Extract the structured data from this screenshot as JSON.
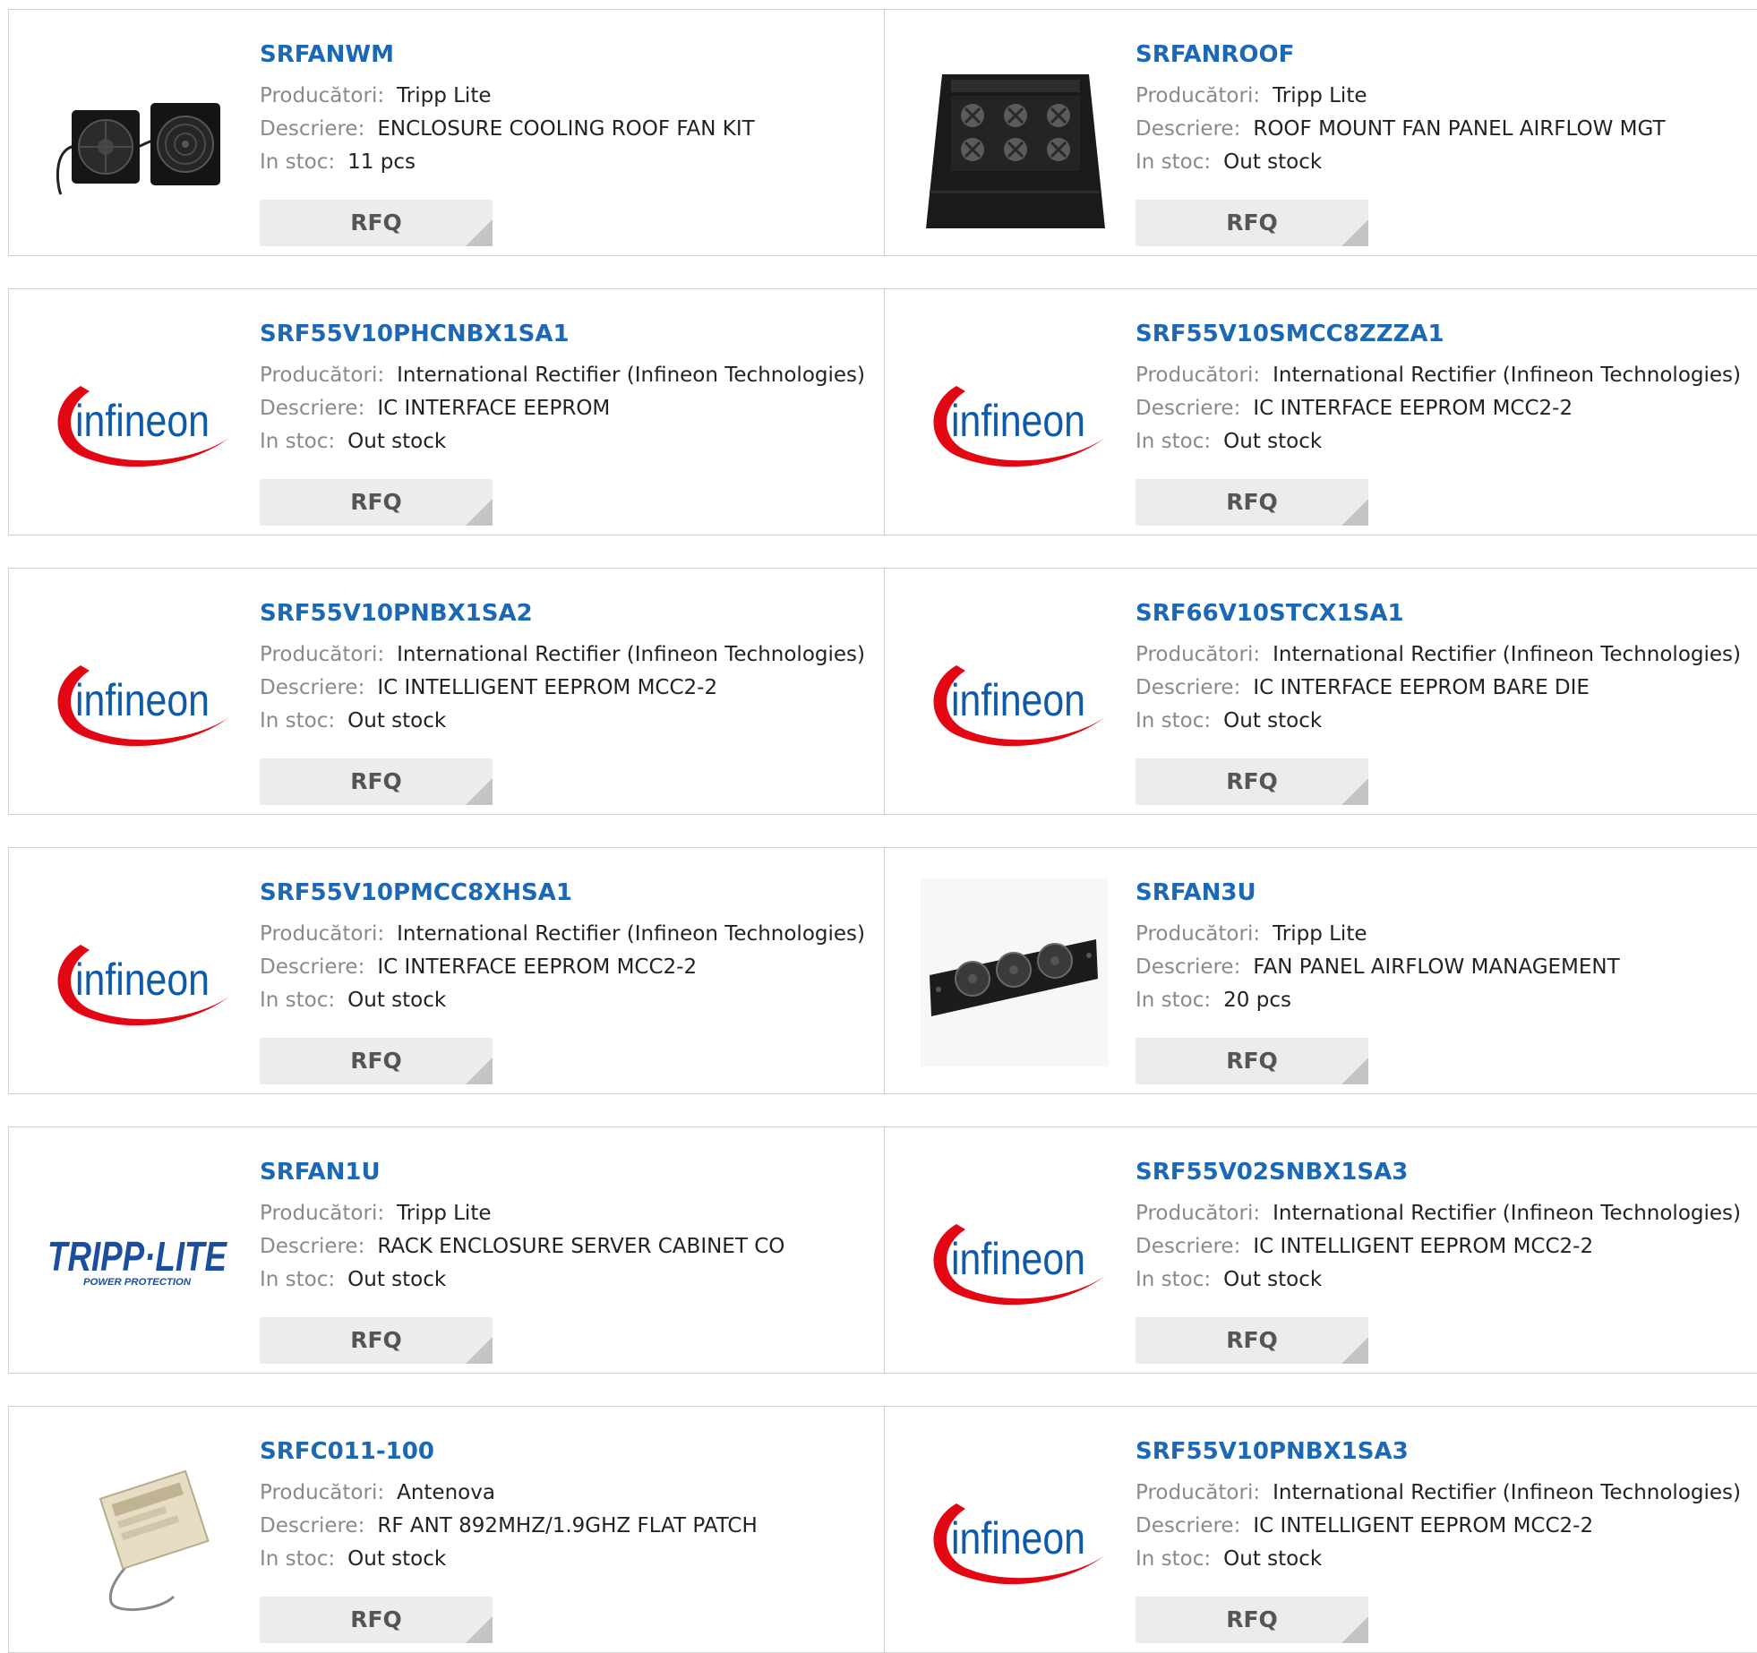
{
  "labels": {
    "manufacturer": "Producători:",
    "description": "Descriere:",
    "stock": "In stoc:",
    "rfq": "RFQ"
  },
  "products": [
    {
      "part": "SRFANWM",
      "manufacturer": "Tripp Lite",
      "description": "ENCLOSURE COOLING ROOF FAN KIT",
      "stock": "11 pcs",
      "image": "twin-fan-kit-image"
    },
    {
      "part": "SRFANROOF",
      "manufacturer": "Tripp Lite",
      "description": "ROOF MOUNT FAN PANEL AIRFLOW MGT",
      "stock": "Out stock",
      "image": "roof-fan-panel-image"
    },
    {
      "part": "SRF55V10PHCNBX1SA1",
      "manufacturer": "International Rectifier (Infineon Technologies)",
      "description": "IC INTERFACE EEPROM",
      "stock": "Out stock",
      "image": "infineon-logo"
    },
    {
      "part": "SRF55V10SMCC8ZZZA1",
      "manufacturer": "International Rectifier (Infineon Technologies)",
      "description": "IC INTERFACE EEPROM MCC2-2",
      "stock": "Out stock",
      "image": "infineon-logo"
    },
    {
      "part": "SRF55V10PNBX1SA2",
      "manufacturer": "International Rectifier (Infineon Technologies)",
      "description": "IC INTELLIGENT EEPROM MCC2-2",
      "stock": "Out stock",
      "image": "infineon-logo"
    },
    {
      "part": "SRF66V10STCX1SA1",
      "manufacturer": "International Rectifier (Infineon Technologies)",
      "description": "IC INTERFACE EEPROM BARE DIE",
      "stock": "Out stock",
      "image": "infineon-logo"
    },
    {
      "part": "SRF55V10PMCC8XHSA1",
      "manufacturer": "International Rectifier (Infineon Technologies)",
      "description": "IC INTERFACE EEPROM MCC2-2",
      "stock": "Out stock",
      "image": "infineon-logo"
    },
    {
      "part": "SRFAN3U",
      "manufacturer": "Tripp Lite",
      "description": "FAN PANEL AIRFLOW MANAGEMENT",
      "stock": "20 pcs",
      "image": "rack-fan-panel-image"
    },
    {
      "part": "SRFAN1U",
      "manufacturer": "Tripp Lite",
      "description": "RACK ENCLOSURE SERVER CABINET CO",
      "stock": "Out stock",
      "image": "tripp-lite-logo"
    },
    {
      "part": "SRF55V02SNBX1SA3",
      "manufacturer": "International Rectifier (Infineon Technologies)",
      "description": "IC INTELLIGENT EEPROM MCC2-2",
      "stock": "Out stock",
      "image": "infineon-logo"
    },
    {
      "part": "SRFC011-100",
      "manufacturer": "Antenova",
      "description": "RF ANT 892MHZ/1.9GHZ FLAT PATCH",
      "stock": "Out stock",
      "image": "flat-patch-antenna-image"
    },
    {
      "part": "SRF55V10PNBX1SA3",
      "manufacturer": "International Rectifier (Infineon Technologies)",
      "description": "IC INTELLIGENT EEPROM MCC2-2",
      "stock": "Out stock",
      "image": "infineon-logo"
    }
  ],
  "logo_text": {
    "infineon": "infineon",
    "tripp_lite": "TRIPP·LITE",
    "tripp_lite_tagline": "POWER PROTECTION"
  },
  "colors": {
    "link": "#1c68b4",
    "infineon_red": "#e30613",
    "infineon_blue": "#0f5aa8",
    "tripp_blue": "#1b4f9c",
    "button_bg": "#ececec"
  }
}
